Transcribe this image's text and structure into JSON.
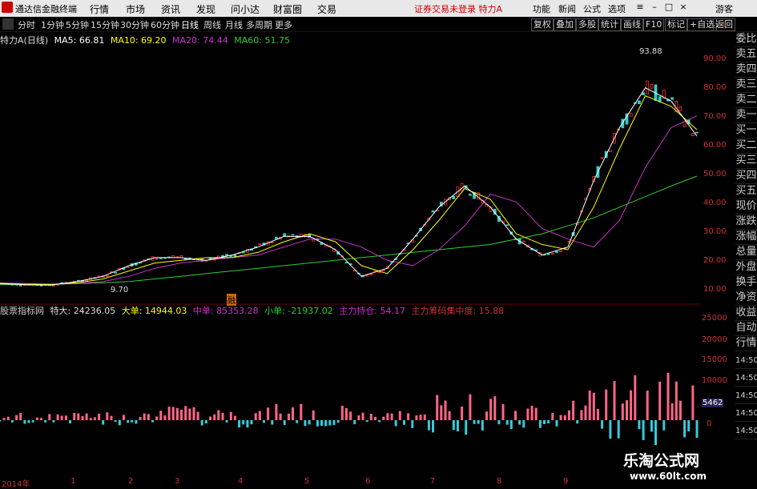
{
  "app": {
    "title": "通达信金融终端",
    "warning": "证券交易未登录 特力A"
  },
  "menu": [
    "行情",
    "市场",
    "资讯",
    "发现",
    "问小达",
    "财富圈",
    "交易"
  ],
  "right_menu": [
    "功能",
    "新闻",
    "公式",
    "选项",
    "游客"
  ],
  "timeframes": [
    "分时",
    "1分钟",
    "5分钟",
    "15分钟",
    "30分钟",
    "60分钟",
    "日线",
    "周线",
    "月线",
    "多周期",
    "更多"
  ],
  "active_timeframe": "日线",
  "toolbar": [
    "复权",
    "叠加",
    "多股",
    "统计",
    "画线",
    "F10",
    "标记",
    "+自选",
    "返回"
  ],
  "price_legend": {
    "name": "特力A(日线)",
    "ma5": "MA5: 66.81",
    "ma10": "MA10: 69.20",
    "ma20": "MA20: 74.44",
    "ma60": "MA60: 51.75"
  },
  "indicator_legend": {
    "name": "股票指标网",
    "tedan": "特大: 24236.05",
    "dadan": "大单: 14944.03",
    "zhongdan": "中单: 85353.28",
    "xiaodan": "小单: -21937.02",
    "zhuli": "主力持仓: 54.17",
    "choumaj": "主力筹码集中度: 15.88"
  },
  "price_labels": {
    "high": "93.88",
    "low": "9.70"
  },
  "marker": "融",
  "right_panel": [
    "委比",
    "卖五",
    "卖四",
    "卖三",
    "卖二",
    "卖一",
    "买一",
    "买二",
    "买三",
    "买四",
    "买五",
    "现价",
    "涨跌",
    "涨幅",
    "总量",
    "外盘",
    "换手",
    "净资",
    "收益",
    "自动",
    "行情"
  ],
  "price_axis": [
    "90.00",
    "80.00",
    "70.00",
    "60.00",
    "50.00",
    "40.00",
    "30.00",
    "20.00",
    "10.00"
  ],
  "vol_axis": [
    "25000",
    "20000",
    "15000",
    "10000",
    "5000",
    "0"
  ],
  "vol_axis_right": [
    "14:50",
    "14:50",
    "14:50",
    "14:50",
    "14:50",
    "14:50",
    "14:50"
  ],
  "vol_current": "5462",
  "x_labels": [
    "2014年",
    "1",
    "2",
    "3",
    "4",
    "5",
    "6",
    "7",
    "8",
    "9"
  ],
  "watermark": {
    "cn": "乐淘公式网",
    "url": "www.60lt.com"
  },
  "colors": {
    "up": "#ff3333",
    "down": "#33cccc",
    "ma5": "#ffffff",
    "ma10": "#ffff00",
    "ma20": "#cc33cc",
    "ma60": "#33cc33",
    "vol_up": "#ff6688",
    "vol_down": "#33ccdd"
  },
  "chart_data": {
    "type": "line",
    "title": "特力A(日线)",
    "series": [
      {
        "name": "MA60",
        "values": [
          10.8,
          10.9,
          11.0,
          11.2,
          11.5,
          12,
          13,
          14,
          15,
          16,
          17,
          18,
          19,
          20,
          21,
          22,
          23,
          24,
          25,
          26,
          28,
          30,
          33,
          36,
          40,
          44,
          48,
          51.75
        ]
      },
      {
        "name": "MA20",
        "values": [
          11.5,
          11.2,
          11.0,
          11.3,
          12,
          14,
          17,
          19,
          20,
          21,
          22,
          25,
          28,
          28,
          25,
          20,
          18,
          24,
          33,
          45,
          42,
          32,
          28,
          25,
          35,
          55,
          70,
          74.44
        ]
      },
      {
        "name": "MA10",
        "values": [
          11.3,
          11.0,
          10.9,
          11.5,
          13,
          16,
          19,
          20,
          21,
          21,
          23,
          27,
          30,
          27,
          18,
          15,
          24,
          35,
          47,
          43,
          30,
          26,
          24,
          40,
          62,
          82,
          78,
          69.2
        ]
      },
      {
        "name": "MA5",
        "values": [
          11.2,
          10.8,
          10.7,
          12,
          14,
          18,
          21,
          21,
          20,
          22,
          25,
          29,
          29,
          24,
          14,
          17,
          28,
          40,
          48,
          40,
          28,
          22,
          25,
          50,
          70,
          85,
          80,
          66.81
        ]
      }
    ],
    "ylim": [
      5,
      100
    ]
  }
}
